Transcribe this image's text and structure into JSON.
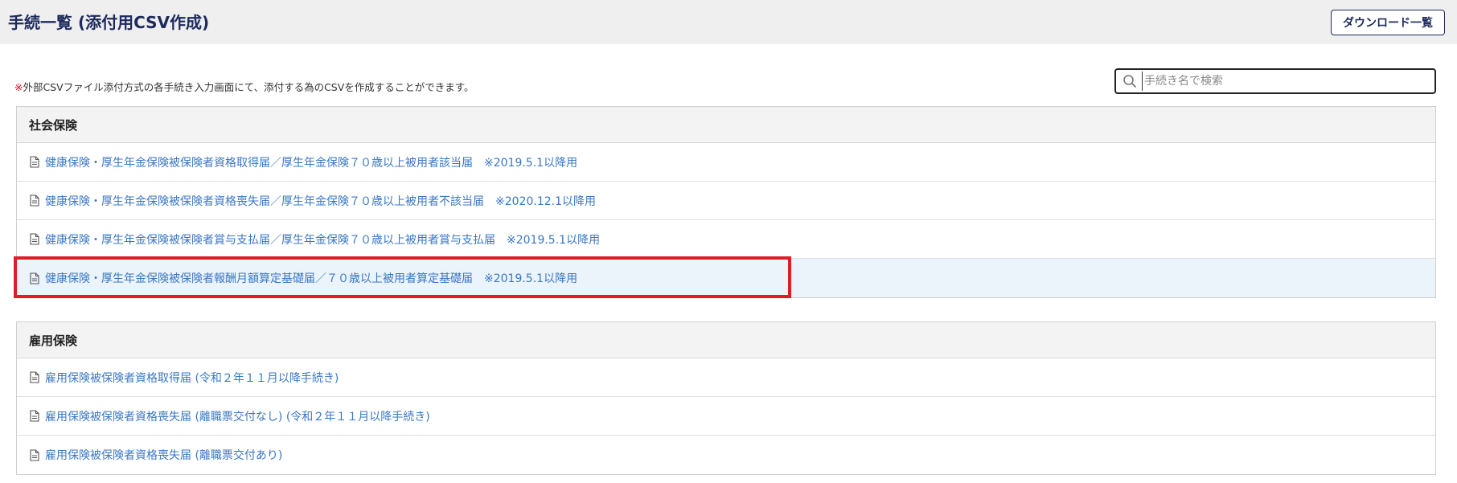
{
  "header": {
    "title": "手続一覧 (添付用CSV作成)",
    "download_button": "ダウンロード一覧"
  },
  "notice": {
    "mark": "※",
    "text": "外部CSVファイル添付方式の各手続き入力画面にて、添付する為のCSVを作成することができます。"
  },
  "search": {
    "placeholder": "手続き名で検索",
    "value": ""
  },
  "sections": [
    {
      "title": "社会保険",
      "items": [
        {
          "label": "健康保険・厚生年金保険被保険者資格取得届／厚生年金保険７０歳以上被用者該当届　※2019.5.1以降用"
        },
        {
          "label": "健康保険・厚生年金保険被保険者資格喪失届／厚生年金保険７０歳以上被用者不該当届　※2020.12.1以降用"
        },
        {
          "label": "健康保険・厚生年金保険被保険者賞与支払届／厚生年金保険７０歳以上被用者賞与支払届　※2019.5.1以降用"
        },
        {
          "label": "健康保険・厚生年金保険被保険者報酬月額算定基礎届／７０歳以上被用者算定基礎届　※2019.5.1以降用",
          "highlighted": true
        }
      ]
    },
    {
      "title": "雇用保険",
      "items": [
        {
          "label": "雇用保険被保険者資格取得届 (令和２年１１月以降手続き)"
        },
        {
          "label": "雇用保険被保険者資格喪失届 (離職票交付なし) (令和２年１１月以降手続き)"
        },
        {
          "label": "雇用保険被保険者資格喪失届 (離職票交付あり)"
        }
      ]
    }
  ],
  "colors": {
    "title": "#1d2a5c",
    "link": "#3a77c4",
    "notice_mark": "#e60012",
    "highlight_row": "#ebf3fb",
    "outline": "#e01d25"
  },
  "icons": {
    "search": "search-icon",
    "document": "document-icon"
  }
}
